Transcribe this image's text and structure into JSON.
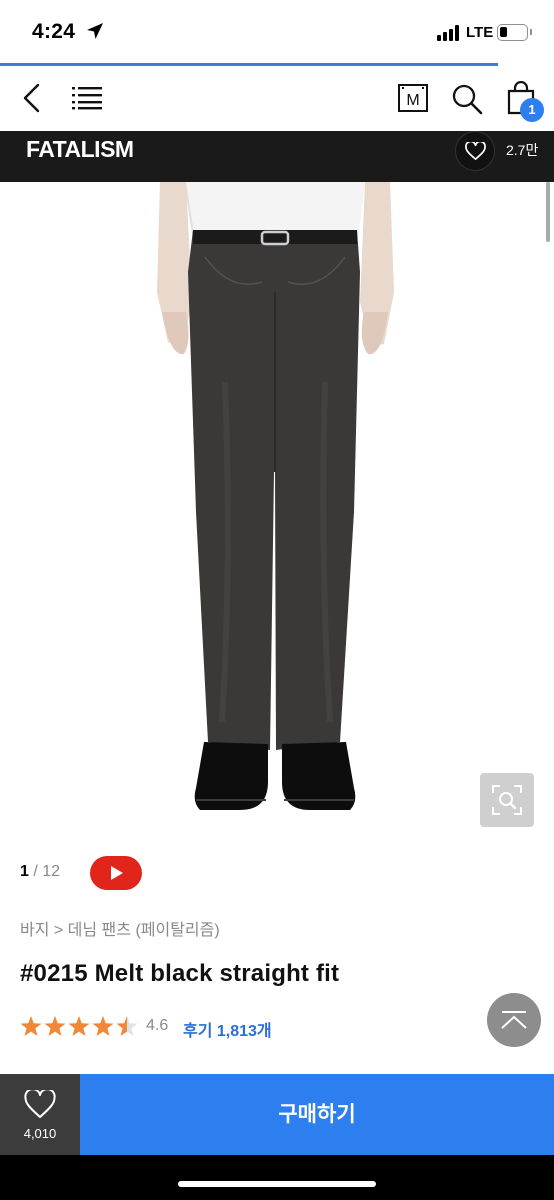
{
  "status": {
    "time": "4:24",
    "network": "LTE"
  },
  "nav": {
    "menu_icon": "M"
  },
  "brand": {
    "name": "FATALISM",
    "likes": "2.7만"
  },
  "cart": {
    "count": "1"
  },
  "gallery": {
    "current": "1",
    "separator": "/",
    "total": "12"
  },
  "product": {
    "breadcrumb": "바지 > 데님 팬츠 (페이탈리즘)",
    "title": "#0215 Melt black straight fit",
    "rating": "4.6",
    "stars": 4.5,
    "reviews_label": "후기 1,813개"
  },
  "bottom": {
    "wish_count": "4,010",
    "buy_label": "구매하기"
  },
  "colors": {
    "accent": "#2d7ff0",
    "brand_bar": "#1a1a1a",
    "youtube": "#e1251b",
    "star": "#f0883a",
    "review_link": "#2a6ed6"
  }
}
